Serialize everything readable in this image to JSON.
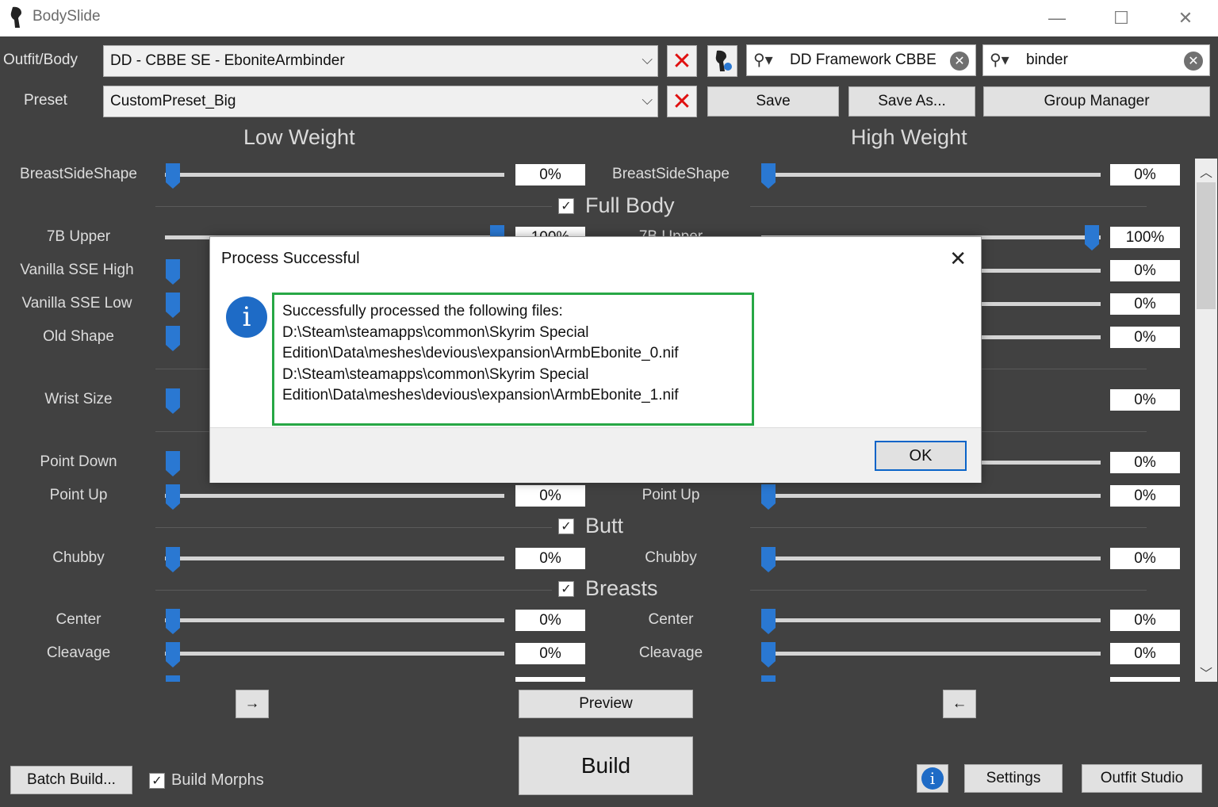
{
  "window": {
    "title": "BodySlide",
    "minimize_icon": "minimize-icon",
    "maximize_icon": "maximize-icon",
    "close_icon": "close-icon"
  },
  "top": {
    "outfit_label": "Outfit/Body",
    "outfit_value": "DD - CBBE SE - EboniteArmbinder",
    "preset_label": "Preset",
    "preset_value": "CustomPreset_Big",
    "group_filter": "DD Framework CBBE",
    "outfit_filter": "binder",
    "save": "Save",
    "save_as": "Save As...",
    "group_manager": "Group Manager"
  },
  "columns": {
    "low": "Low Weight",
    "high": "High Weight"
  },
  "sliders": {
    "breast_side_shape": {
      "label": "BreastSideShape",
      "low": "0%",
      "high": "0%"
    },
    "upper_7b": {
      "label": "7B Upper",
      "low": "100%",
      "high": "100%"
    },
    "vanilla_high": {
      "label": "Vanilla SSE High",
      "high": "0%"
    },
    "vanilla_low": {
      "label": "Vanilla SSE Low",
      "high": "0%"
    },
    "old_shape": {
      "label": "Old Shape",
      "high": "0%"
    },
    "wrist_size": {
      "label": "Wrist Size",
      "high": "0%"
    },
    "point_down": {
      "label": "Point Down",
      "high": "0%"
    },
    "point_up": {
      "label": "Point Up",
      "low": "0%",
      "high": "0%"
    },
    "chubby": {
      "label": "Chubby",
      "low": "0%",
      "high": "0%"
    },
    "center": {
      "label": "Center",
      "low": "0%",
      "high": "0%"
    },
    "cleavage": {
      "label": "Cleavage",
      "low": "0%",
      "high": "0%"
    }
  },
  "groups": {
    "full_body": "Full Body",
    "butt": "Butt",
    "breasts": "Breasts"
  },
  "bottom": {
    "copy_right": "→",
    "copy_left": "←",
    "preview": "Preview",
    "build": "Build",
    "batch_build": "Batch Build...",
    "build_morphs": "Build Morphs",
    "settings": "Settings",
    "outfit_studio": "Outfit Studio"
  },
  "dialog": {
    "title": "Process Successful",
    "line1": "Successfully processed the following files:",
    "line2": "D:\\Steam\\steamapps\\common\\Skyrim Special",
    "line3": "Edition\\Data\\meshes\\devious\\expansion\\ArmbEbonite_0.nif",
    "line4": "D:\\Steam\\steamapps\\common\\Skyrim Special",
    "line5": "Edition\\Data\\meshes\\devious\\expansion\\ArmbEbonite_1.nif",
    "ok": "OK"
  },
  "colors": {
    "accent": "#2a78d2",
    "background": "#414141",
    "highlight_border": "#27a745"
  }
}
